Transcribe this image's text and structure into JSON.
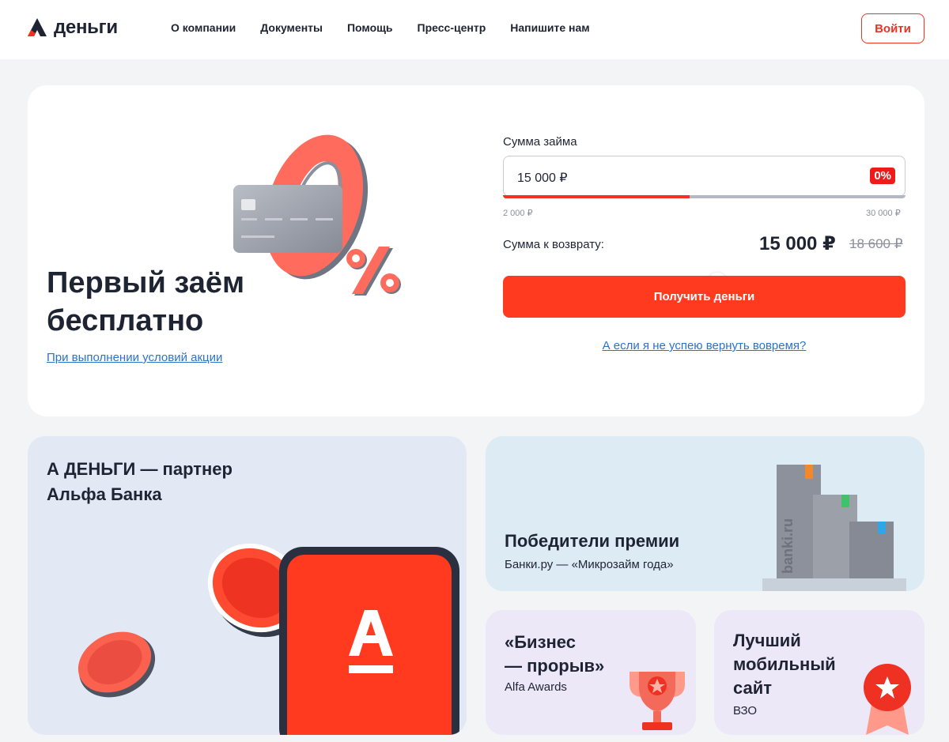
{
  "header": {
    "logo_text": "деньги",
    "nav": [
      "О компании",
      "Документы",
      "Помощь",
      "Пресс-центр",
      "Напишите нам"
    ],
    "login_label": "Войти"
  },
  "hero": {
    "title_line1": "Первый заём",
    "title_line2": "бесплатно",
    "subtitle_link": "При выполнении условий акции",
    "calculator": {
      "amount_label": "Сумма займа",
      "amount_value": "15 000 ₽",
      "rate_badge": "0%",
      "slider_min": "2 000 ₽",
      "slider_max": "30 000 ₽",
      "slider_fraction": 0.464,
      "return_label": "Сумма к возврату:",
      "return_value": "15 000 ₽",
      "return_old_value": "18 600 ₽",
      "submit_label": "Получить деньги",
      "late_link": "А если я не успею вернуть вовремя?"
    }
  },
  "cards": {
    "alfa": {
      "title_line1": "А ДЕНЬГИ — партнер",
      "title_line2": "Альфа Банка"
    },
    "prize": {
      "title": "Победители премии",
      "subtitle": "Банки.ру — «Микрозайм года»",
      "building_text": "banki.ru"
    },
    "business": {
      "title_line1": "«Бизнес",
      "title_line2": "— прорыв»",
      "subtitle": "Alfa Awards"
    },
    "mobile": {
      "title_line1": "Лучший",
      "title_line2": "мобильный",
      "title_line3": "сайт",
      "subtitle": "ВЗО"
    }
  },
  "colors": {
    "accent": "#ef3124",
    "button": "#ff3a1f",
    "link": "#2a74c8",
    "text": "#1f2433",
    "page_bg": "#f3f4f6"
  },
  "icons": [
    "logo-mark-icon",
    "credit-card-icon",
    "zero-percent-icon",
    "coin-icon",
    "alfa-a-icon",
    "building-icon",
    "trophy-icon",
    "medal-icon"
  ]
}
